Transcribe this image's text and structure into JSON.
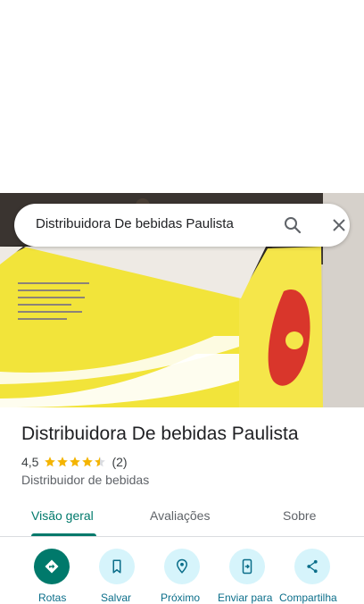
{
  "search": {
    "query": "Distribuidora De bebidas Paulista"
  },
  "place": {
    "name": "Distribuidora De bebidas Paulista",
    "rating": "4,5",
    "review_count": "(2)",
    "stars": 4.5,
    "category": "Distribuidor de bebidas"
  },
  "tabs": [
    {
      "label": "Visão geral",
      "active": true
    },
    {
      "label": "Avaliações",
      "active": false
    },
    {
      "label": "Sobre",
      "active": false
    }
  ],
  "actions": [
    {
      "label": "Rotas",
      "icon": "directions-icon"
    },
    {
      "label": "Salvar",
      "icon": "bookmark-icon"
    },
    {
      "label": "Próximo",
      "icon": "nearby-icon"
    },
    {
      "label": "Enviar para",
      "icon": "send-to-phone-icon"
    },
    {
      "label": "Compartilha",
      "icon": "share-icon"
    }
  ],
  "colors": {
    "accent": "#00796b",
    "action_bg": "#d6f4fb",
    "star": "#f4b400"
  }
}
